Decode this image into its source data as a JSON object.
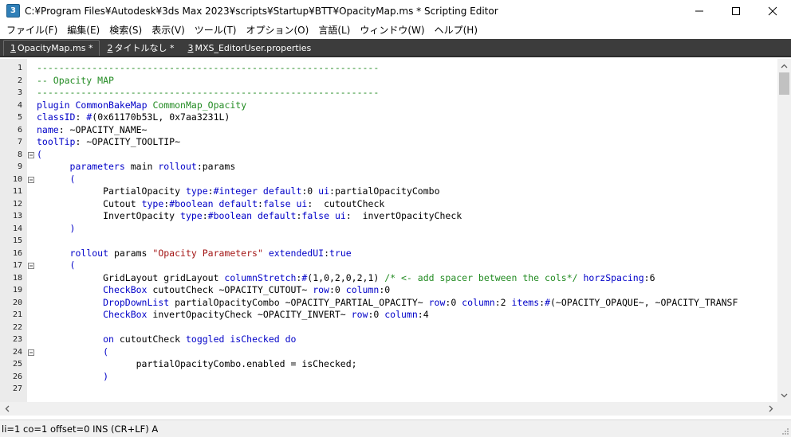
{
  "window": {
    "icon_glyph": "3",
    "title": "C:¥Program Files¥Autodesk¥3ds Max 2023¥scripts¥Startup¥BTT¥OpacityMap.ms * Scripting Editor"
  },
  "menu": [
    {
      "label": "ファイル(F)"
    },
    {
      "label": "編集(E)"
    },
    {
      "label": "検索(S)"
    },
    {
      "label": "表示(V)"
    },
    {
      "label": "ツール(T)"
    },
    {
      "label": "オプション(O)"
    },
    {
      "label": "言語(L)"
    },
    {
      "label": "ウィンドウ(W)"
    },
    {
      "label": "ヘルプ(H)"
    }
  ],
  "tabs": [
    {
      "num": "1",
      "label": "OpacityMap.ms *",
      "active": true
    },
    {
      "num": "2",
      "label": "タイトルなし *",
      "active": false
    },
    {
      "num": "3",
      "label": "MXS_EditorUser.properties",
      "active": false
    }
  ],
  "colors": {
    "comment": "#228b22",
    "keyword": "#0000c8",
    "string": "#a31515",
    "tabbar": "#3c3c3c"
  },
  "icons": {
    "minimize": "minimize-icon",
    "maximize": "maximize-icon",
    "close": "close-icon",
    "fold_open": "fold-minus-icon"
  },
  "code_lines": [
    {
      "n": "1",
      "fold": "",
      "tokens": [
        {
          "c": "c-dash",
          "t": "--------------------------------------------------------------"
        }
      ]
    },
    {
      "n": "2",
      "fold": "",
      "tokens": [
        {
          "c": "c-comment",
          "t": "-- Opacity MAP"
        }
      ]
    },
    {
      "n": "3",
      "fold": "",
      "tokens": [
        {
          "c": "c-dash",
          "t": "--------------------------------------------------------------"
        }
      ]
    },
    {
      "n": "4",
      "fold": "",
      "tokens": [
        {
          "c": "c-kw",
          "t": "plugin"
        },
        {
          "c": "c-plain",
          "t": " "
        },
        {
          "c": "c-kw",
          "t": "CommonBakeMap"
        },
        {
          "c": "c-plain",
          "t": " "
        },
        {
          "c": "c-comment",
          "t": "CommonMap_Opacity"
        }
      ]
    },
    {
      "n": "5",
      "fold": "",
      "tokens": [
        {
          "c": "c-kw",
          "t": "classID"
        },
        {
          "c": "c-plain",
          "t": ": "
        },
        {
          "c": "c-kw",
          "t": "#"
        },
        {
          "c": "c-plain",
          "t": "(0x61170b53L, 0x7aa3231L)"
        }
      ]
    },
    {
      "n": "6",
      "fold": "",
      "tokens": [
        {
          "c": "c-kw",
          "t": "name"
        },
        {
          "c": "c-plain",
          "t": ": ~OPACITY_NAME~"
        }
      ]
    },
    {
      "n": "7",
      "fold": "",
      "tokens": [
        {
          "c": "c-kw",
          "t": "toolTip"
        },
        {
          "c": "c-plain",
          "t": ": ~OPACITY_TOOLTIP~"
        }
      ]
    },
    {
      "n": "8",
      "fold": "open",
      "tokens": [
        {
          "c": "c-kw",
          "t": "("
        }
      ]
    },
    {
      "n": "9",
      "fold": "",
      "tokens": [
        {
          "c": "c-plain",
          "t": "      "
        },
        {
          "c": "c-kw",
          "t": "parameters"
        },
        {
          "c": "c-plain",
          "t": " main "
        },
        {
          "c": "c-kw",
          "t": "rollout"
        },
        {
          "c": "c-plain",
          "t": ":params"
        }
      ]
    },
    {
      "n": "10",
      "fold": "open",
      "tokens": [
        {
          "c": "c-plain",
          "t": "      "
        },
        {
          "c": "c-kw",
          "t": "("
        }
      ]
    },
    {
      "n": "11",
      "fold": "",
      "tokens": [
        {
          "c": "c-plain",
          "t": "            PartialOpacity "
        },
        {
          "c": "c-kw",
          "t": "type"
        },
        {
          "c": "c-plain",
          "t": ":"
        },
        {
          "c": "c-kw",
          "t": "#integer"
        },
        {
          "c": "c-plain",
          "t": " "
        },
        {
          "c": "c-kw",
          "t": "default"
        },
        {
          "c": "c-plain",
          "t": ":0 "
        },
        {
          "c": "c-kw",
          "t": "ui"
        },
        {
          "c": "c-plain",
          "t": ":partialOpacityCombo"
        }
      ]
    },
    {
      "n": "12",
      "fold": "",
      "tokens": [
        {
          "c": "c-plain",
          "t": "            Cutout "
        },
        {
          "c": "c-kw",
          "t": "type"
        },
        {
          "c": "c-plain",
          "t": ":"
        },
        {
          "c": "c-kw",
          "t": "#boolean"
        },
        {
          "c": "c-plain",
          "t": " "
        },
        {
          "c": "c-kw",
          "t": "default"
        },
        {
          "c": "c-plain",
          "t": ":"
        },
        {
          "c": "c-kw",
          "t": "false"
        },
        {
          "c": "c-plain",
          "t": " "
        },
        {
          "c": "c-kw",
          "t": "ui"
        },
        {
          "c": "c-plain",
          "t": ":  cutoutCheck"
        }
      ]
    },
    {
      "n": "13",
      "fold": "",
      "tokens": [
        {
          "c": "c-plain",
          "t": "            InvertOpacity "
        },
        {
          "c": "c-kw",
          "t": "type"
        },
        {
          "c": "c-plain",
          "t": ":"
        },
        {
          "c": "c-kw",
          "t": "#boolean"
        },
        {
          "c": "c-plain",
          "t": " "
        },
        {
          "c": "c-kw",
          "t": "default"
        },
        {
          "c": "c-plain",
          "t": ":"
        },
        {
          "c": "c-kw",
          "t": "false"
        },
        {
          "c": "c-plain",
          "t": " "
        },
        {
          "c": "c-kw",
          "t": "ui"
        },
        {
          "c": "c-plain",
          "t": ":  invertOpacityCheck"
        }
      ]
    },
    {
      "n": "14",
      "fold": "",
      "tokens": [
        {
          "c": "c-plain",
          "t": "      "
        },
        {
          "c": "c-kw",
          "t": ")"
        }
      ]
    },
    {
      "n": "15",
      "fold": "",
      "tokens": []
    },
    {
      "n": "16",
      "fold": "",
      "tokens": [
        {
          "c": "c-plain",
          "t": "      "
        },
        {
          "c": "c-kw",
          "t": "rollout"
        },
        {
          "c": "c-plain",
          "t": " params "
        },
        {
          "c": "c-str",
          "t": "\"Opacity Parameters\""
        },
        {
          "c": "c-plain",
          "t": " "
        },
        {
          "c": "c-kw",
          "t": "extendedUI"
        },
        {
          "c": "c-plain",
          "t": ":"
        },
        {
          "c": "c-kw",
          "t": "true"
        }
      ]
    },
    {
      "n": "17",
      "fold": "open",
      "tokens": [
        {
          "c": "c-plain",
          "t": "      "
        },
        {
          "c": "c-kw",
          "t": "("
        }
      ]
    },
    {
      "n": "18",
      "fold": "",
      "tokens": [
        {
          "c": "c-plain",
          "t": "            GridLayout gridLayout "
        },
        {
          "c": "c-kw",
          "t": "columnStretch"
        },
        {
          "c": "c-plain",
          "t": ":"
        },
        {
          "c": "c-kw",
          "t": "#"
        },
        {
          "c": "c-plain",
          "t": "(1,0,2,0,2,1) "
        },
        {
          "c": "c-comment",
          "t": "/* <- add spacer between the cols*/"
        },
        {
          "c": "c-plain",
          "t": " "
        },
        {
          "c": "c-kw",
          "t": "horzSpacing"
        },
        {
          "c": "c-plain",
          "t": ":6"
        }
      ]
    },
    {
      "n": "19",
      "fold": "",
      "tokens": [
        {
          "c": "c-plain",
          "t": "            "
        },
        {
          "c": "c-kw",
          "t": "CheckBox"
        },
        {
          "c": "c-plain",
          "t": " cutoutCheck ~OPACITY_CUTOUT~ "
        },
        {
          "c": "c-kw",
          "t": "row"
        },
        {
          "c": "c-plain",
          "t": ":0 "
        },
        {
          "c": "c-kw",
          "t": "column"
        },
        {
          "c": "c-plain",
          "t": ":0"
        }
      ]
    },
    {
      "n": "20",
      "fold": "",
      "tokens": [
        {
          "c": "c-plain",
          "t": "            "
        },
        {
          "c": "c-kw",
          "t": "DropDownList"
        },
        {
          "c": "c-plain",
          "t": " partialOpacityCombo ~OPACITY_PARTIAL_OPACITY~ "
        },
        {
          "c": "c-kw",
          "t": "row"
        },
        {
          "c": "c-plain",
          "t": ":0 "
        },
        {
          "c": "c-kw",
          "t": "column"
        },
        {
          "c": "c-plain",
          "t": ":2 "
        },
        {
          "c": "c-kw",
          "t": "items"
        },
        {
          "c": "c-plain",
          "t": ":"
        },
        {
          "c": "c-kw",
          "t": "#"
        },
        {
          "c": "c-plain",
          "t": "(~OPACITY_OPAQUE~, ~OPACITY_TRANSF"
        }
      ]
    },
    {
      "n": "21",
      "fold": "",
      "tokens": [
        {
          "c": "c-plain",
          "t": "            "
        },
        {
          "c": "c-kw",
          "t": "CheckBox"
        },
        {
          "c": "c-plain",
          "t": " invertOpacityCheck ~OPACITY_INVERT~ "
        },
        {
          "c": "c-kw",
          "t": "row"
        },
        {
          "c": "c-plain",
          "t": ":0 "
        },
        {
          "c": "c-kw",
          "t": "column"
        },
        {
          "c": "c-plain",
          "t": ":4"
        }
      ]
    },
    {
      "n": "22",
      "fold": "",
      "tokens": []
    },
    {
      "n": "23",
      "fold": "",
      "tokens": [
        {
          "c": "c-plain",
          "t": "            "
        },
        {
          "c": "c-kw",
          "t": "on"
        },
        {
          "c": "c-plain",
          "t": " cutoutCheck "
        },
        {
          "c": "c-kw",
          "t": "toggled"
        },
        {
          "c": "c-plain",
          "t": " "
        },
        {
          "c": "c-kw",
          "t": "isChecked"
        },
        {
          "c": "c-plain",
          "t": " "
        },
        {
          "c": "c-kw",
          "t": "do"
        }
      ]
    },
    {
      "n": "24",
      "fold": "open",
      "tokens": [
        {
          "c": "c-plain",
          "t": "            "
        },
        {
          "c": "c-kw",
          "t": "("
        }
      ]
    },
    {
      "n": "25",
      "fold": "",
      "tokens": [
        {
          "c": "c-plain",
          "t": "                  partialOpacityCombo.enabled = isChecked;"
        }
      ]
    },
    {
      "n": "26",
      "fold": "",
      "tokens": [
        {
          "c": "c-plain",
          "t": "            "
        },
        {
          "c": "c-kw",
          "t": ")"
        }
      ]
    },
    {
      "n": "27",
      "fold": "",
      "tokens": []
    }
  ],
  "status": {
    "text": "li=1 co=1 offset=0 INS (CR+LF) A"
  }
}
